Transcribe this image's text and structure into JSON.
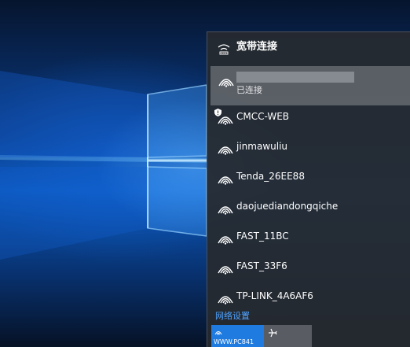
{
  "flyout": {
    "broadband": {
      "label": "宽带连接",
      "icon": "ethernet-dialup-icon"
    },
    "connected_network": {
      "status": "已连接",
      "icon": "wifi-icon"
    },
    "networks": [
      {
        "name": "CMCC-WEB",
        "icon": "wifi-icon",
        "secured": false
      },
      {
        "name": "jinmawuliu",
        "icon": "wifi-icon",
        "secured": true
      },
      {
        "name": "Tenda_26EE88",
        "icon": "wifi-icon",
        "secured": true
      },
      {
        "name": "daojuediandongqiche",
        "icon": "wifi-icon",
        "secured": true
      },
      {
        "name": "FAST_11BC",
        "icon": "wifi-icon",
        "secured": true
      },
      {
        "name": "FAST_33F6",
        "icon": "wifi-icon",
        "secured": true
      },
      {
        "name": "TP-LINK_4A6AF6",
        "icon": "wifi-icon",
        "secured": true
      }
    ],
    "settings_link": "网络设置",
    "quick_actions": {
      "wifi_label": "WWW.PC841",
      "wifi_color": "#1f7be0",
      "airplane_icon": "airplane-icon"
    }
  },
  "colors": {
    "accent": "#1f7be0",
    "link": "#4fa3ff",
    "flyout_bg": "#262a30"
  }
}
